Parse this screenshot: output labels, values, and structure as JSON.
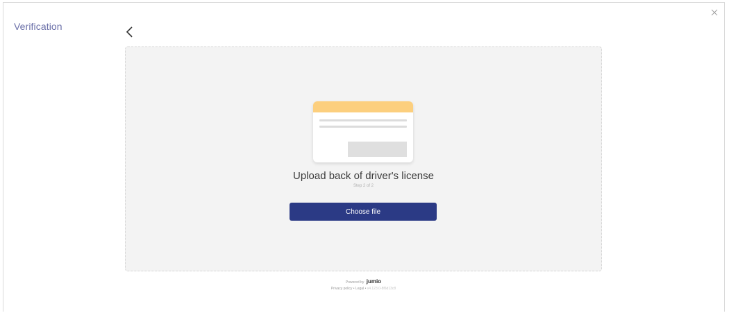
{
  "header": {
    "title": "Verification",
    "back_icon": "chevron-left-icon",
    "close_icon": "close-icon"
  },
  "upload": {
    "heading": "Upload back of driver's license",
    "step": "Step 2 of 2",
    "button_label": "Choose file",
    "illustration_icon": "id-card-back-icon"
  },
  "footer": {
    "powered_by": "Powered by",
    "brand": "jumio",
    "privacy": "Privacy policy",
    "separator": "•",
    "legal": "Legal",
    "version": "v4.123.0-8f6d13c8"
  },
  "colors": {
    "title": "#6a6fa8",
    "button": "#2b3a85",
    "card_header": "#fccf7e",
    "panel": "#f3f3f3"
  }
}
